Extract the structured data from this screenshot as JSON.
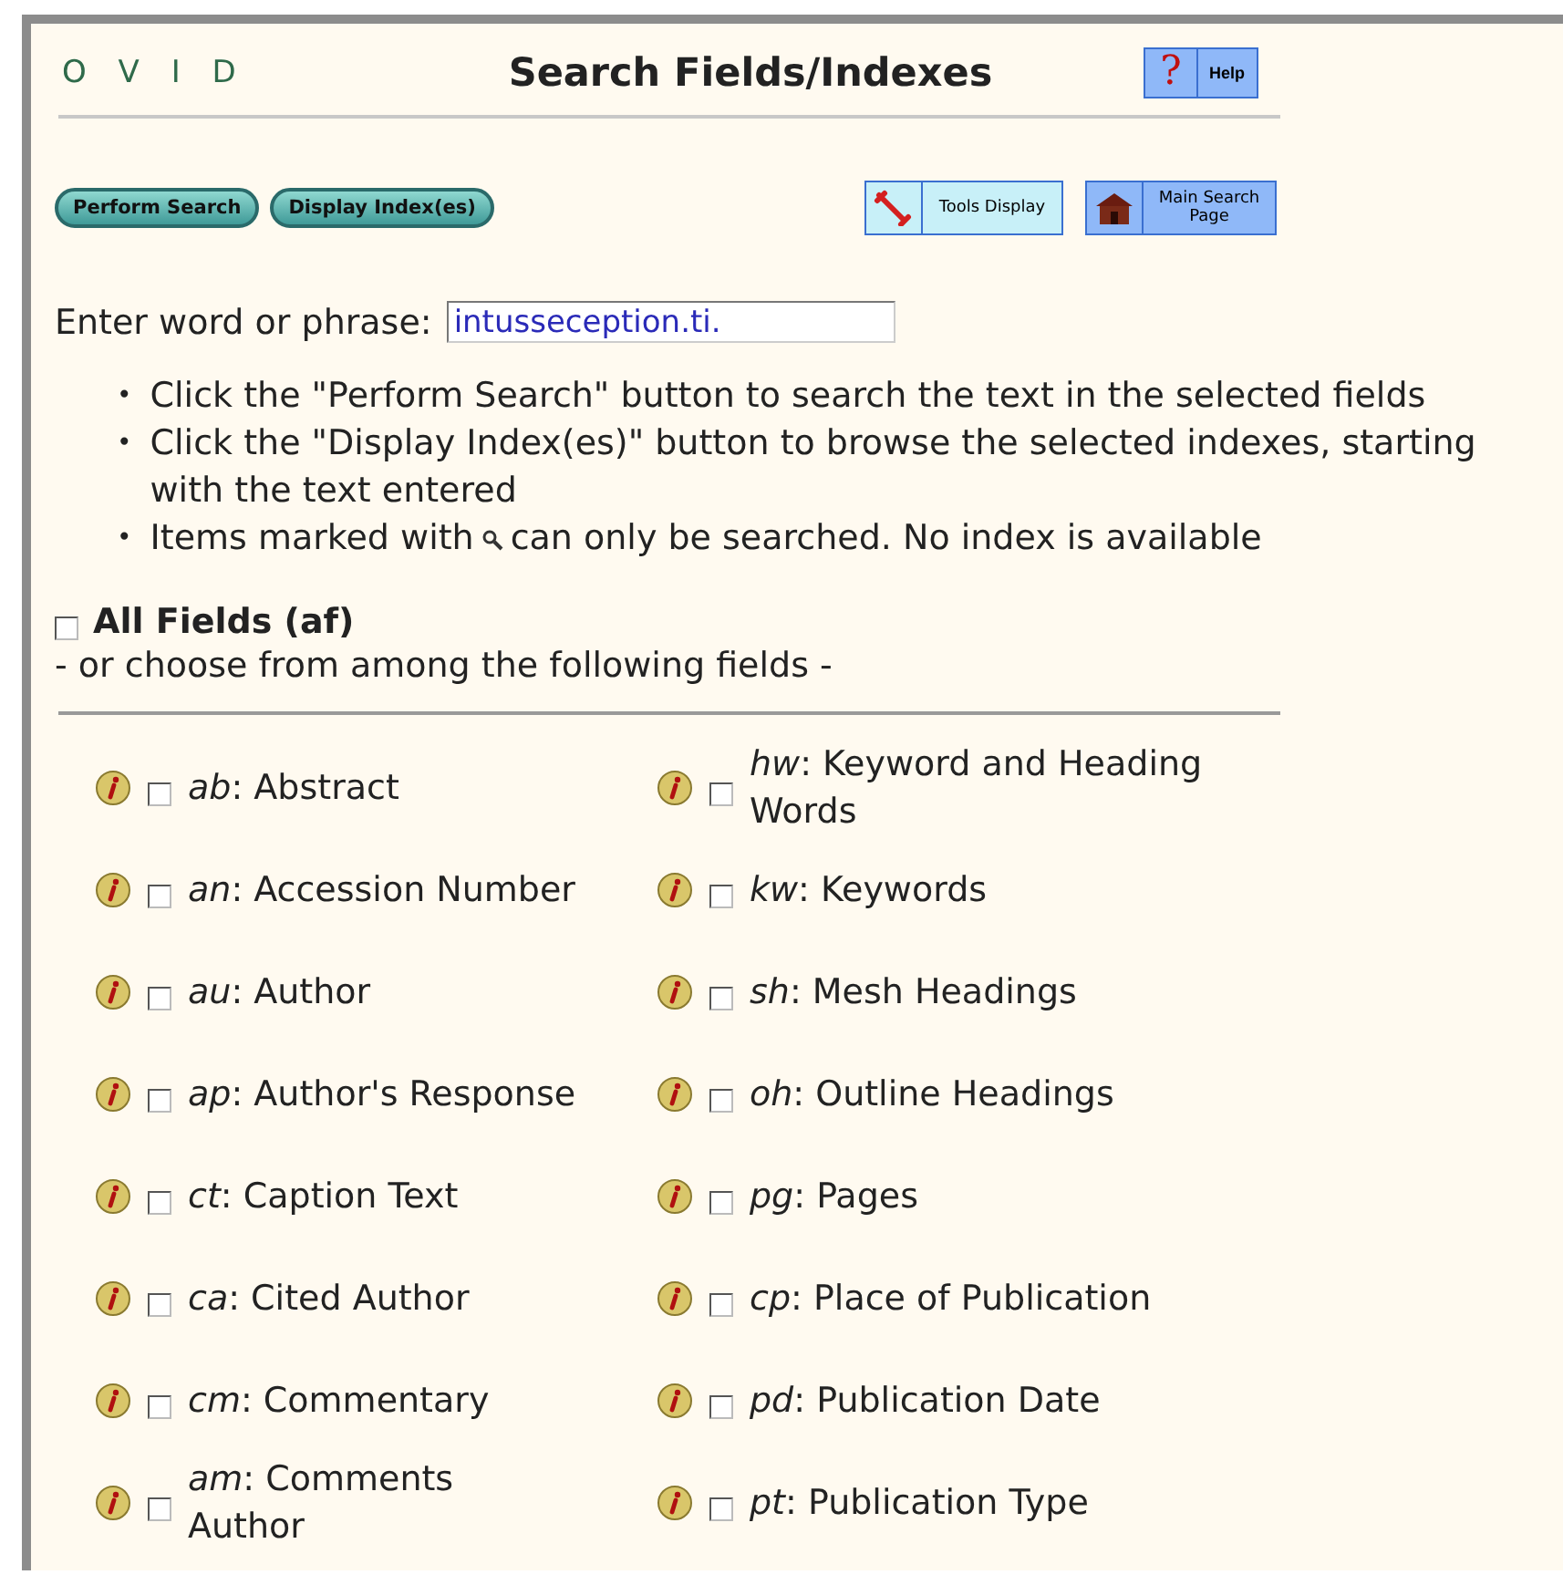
{
  "logo": "O V I D",
  "title": "Search Fields/Indexes",
  "help": {
    "symbol": "?",
    "label": "Help"
  },
  "actions": [
    {
      "label": "Perform Search"
    },
    {
      "label": "Display Index(es)"
    }
  ],
  "tools": [
    {
      "kind": "wrench",
      "label": "Tools Display"
    },
    {
      "kind": "house",
      "label": "Main Search Page"
    }
  ],
  "search": {
    "label": "Enter word or phrase:",
    "value": "intusseception.ti."
  },
  "notes": [
    {
      "kind": "text",
      "marker": "•",
      "text": "Click the \"Perform Search\" button to search the text in the selected fields"
    },
    {
      "kind": "text",
      "marker": "•",
      "text": "Click the \"Display Index(es)\" button to browse the selected indexes, starting with the text entered"
    },
    {
      "kind": "icon_note",
      "marker": "•",
      "before": "Items marked with",
      "after": "can only be searched. No index is available"
    }
  ],
  "all_fields": {
    "label": "All Fields (af)",
    "checked": false
  },
  "choose_text": "- or choose from among the following fields -",
  "fields": [
    {
      "label": "*ab*: Abstract",
      "checked": false
    },
    {
      "label": "*an*: Accession Number",
      "checked": false
    },
    {
      "label": "*au*: Author",
      "checked": false
    },
    {
      "label": "*ap*: Author's Response",
      "checked": false
    },
    {
      "label": "*ct*: Caption Text",
      "checked": false
    },
    {
      "label": "*ca*: Cited Author",
      "checked": false
    },
    {
      "label": "*cm*: Commentary",
      "checked": false
    },
    {
      "label": "*am*: Comments Author",
      "checked": false
    },
    {
      "label": "*hw*: Keyword and Heading Words",
      "checked": false
    },
    {
      "label": "*kw*: Keywords",
      "checked": false
    },
    {
      "label": "*sh*: Mesh Headings",
      "checked": false
    },
    {
      "label": "*oh*: Outline Headings",
      "checked": false
    },
    {
      "label": "*pg*: Pages",
      "checked": false
    },
    {
      "label": "*cp*: Place of Publication",
      "checked": false
    },
    {
      "label": "*pd*: Publication Date",
      "checked": false
    },
    {
      "label": "*pt*: Publication Type",
      "checked": false
    }
  ]
}
